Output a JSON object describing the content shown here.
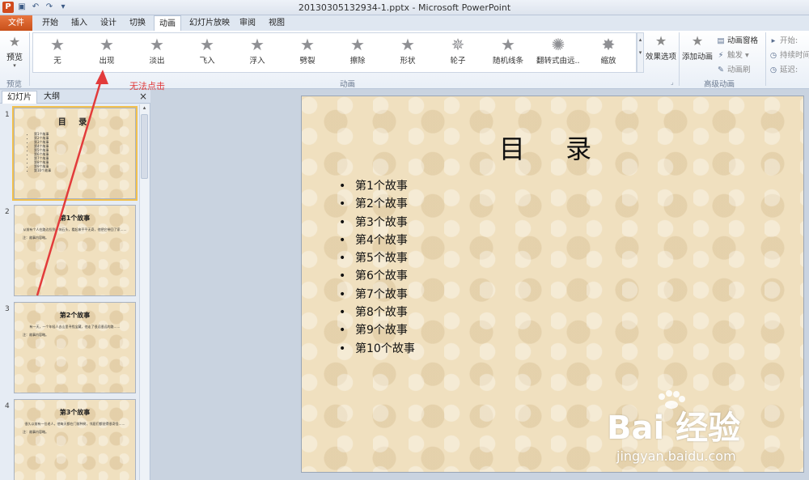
{
  "window": {
    "title": "20130305132934-1.pptx - Microsoft PowerPoint",
    "app_icon": "P"
  },
  "tabs": {
    "file": "文件",
    "items": [
      "开始",
      "插入",
      "设计",
      "切换",
      "动画",
      "幻灯片放映",
      "审阅",
      "视图"
    ],
    "active": "动画"
  },
  "ribbon": {
    "preview_label": "预览",
    "preview_group_label": "预览",
    "animation_group_label": "动画",
    "advanced_group_label": "高级动画",
    "animations": [
      {
        "label": "无",
        "icon": "star-icon"
      },
      {
        "label": "出现",
        "icon": "star-icon"
      },
      {
        "label": "淡出",
        "icon": "star-icon"
      },
      {
        "label": "飞入",
        "icon": "star-icon"
      },
      {
        "label": "浮入",
        "icon": "star-icon"
      },
      {
        "label": "劈裂",
        "icon": "star-icon"
      },
      {
        "label": "擦除",
        "icon": "star-icon"
      },
      {
        "label": "形状",
        "icon": "star-icon"
      },
      {
        "label": "轮子",
        "icon": "star-icon"
      },
      {
        "label": "随机线条",
        "icon": "star-icon"
      },
      {
        "label": "翻转式由远...",
        "icon": "star-icon"
      },
      {
        "label": "缩放",
        "icon": "star-icon"
      }
    ],
    "effect_options": "效果选项",
    "add_animation": "添加动画",
    "animation_pane": "动画窗格",
    "trigger": "触发",
    "animation_painter": "动画刷",
    "start_label": "开始:",
    "duration_label": "持续时间:",
    "delay_label": "延迟:"
  },
  "left_panel": {
    "tabs": [
      "幻灯片",
      "大纲"
    ],
    "active_tab": "幻灯片",
    "close": "×",
    "thumbnails": [
      {
        "number": "1",
        "title": "目 录",
        "list": [
          "第1个故事",
          "第2个故事",
          "第3个故事",
          "第4个故事",
          "第5个故事",
          "第6个故事",
          "第7个故事",
          "第8个故事",
          "第9个故事",
          "第10个故事"
        ]
      },
      {
        "number": "2",
        "title": "第1个故事",
        "body": "从前有个人在路边捡到一块石头，看起来平平无奇，他把它带回了家……",
        "note": "注：故事内容略。"
      },
      {
        "number": "3",
        "title": "第2个故事",
        "body": "有一天，一个年轻人去山里寻找宝藏，他走了很远很远的路……",
        "note": "注：故事内容略。"
      },
      {
        "number": "4",
        "title": "第3个故事",
        "body": "很久以前有一位老人，他每天都在门前种树，邻居们都觉得很奇怪……",
        "note": "注：故事内容略。"
      }
    ]
  },
  "slide": {
    "title": "目 录",
    "bullet": "•",
    "items": [
      "第1个故事",
      "第2个故事",
      "第3个故事",
      "第4个故事",
      "第5个故事",
      "第6个故事",
      "第7个故事",
      "第8个故事",
      "第9个故事",
      "第10个故事"
    ]
  },
  "annotation": {
    "text": "无法点击",
    "color": "#e23b3b"
  },
  "watermark": {
    "logo": "Bai  经验",
    "url": "jingyan.baidu.com"
  },
  "colors": {
    "file_tab": "#d05a24",
    "accent": "#3b5a85",
    "slide_bg": "#f0e0bf"
  }
}
